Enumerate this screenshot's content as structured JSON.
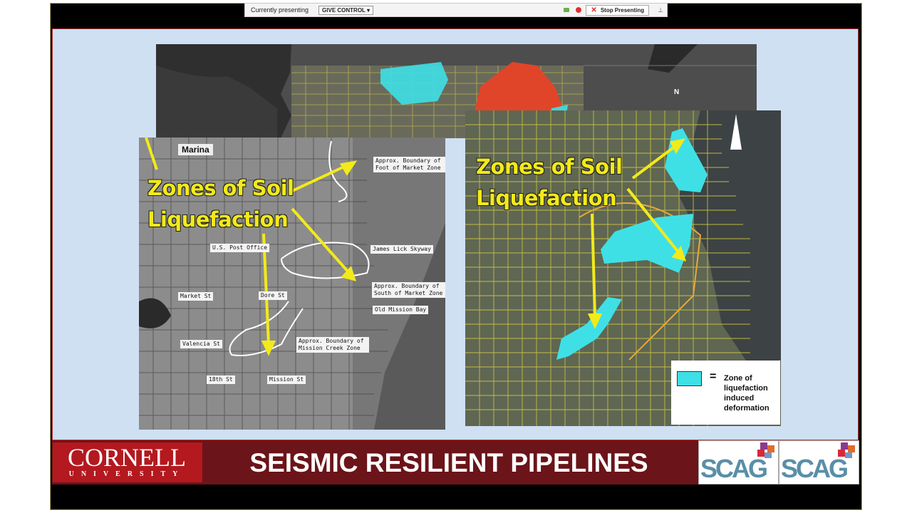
{
  "toolbar": {
    "currently_presenting": "Currently presenting",
    "give_control": "GIVE CONTROL",
    "stop_presenting": "Stop Presenting"
  },
  "slide": {
    "title": "SEISMIC RESILIENT PIPELINES",
    "cornell_line1": "CORNELL",
    "cornell_line2": "UNIVERSITY",
    "scag_logo": "SCAG",
    "left_map": {
      "heading_line1": "Zones of Soil",
      "heading_line2": "Liquefaction",
      "marina": "Marina",
      "labels": [
        "Approx. Boundary of Foot of Market Zone",
        "U.S. Post Office",
        "James Lick Skyway",
        "Approx. Boundary of South of Market Zone",
        "Market St",
        "Dore St",
        "Old Mission Bay",
        "Valencia St",
        "Approx. Boundary of Mission Creek Zone",
        "18th St",
        "Mission St"
      ]
    },
    "right_map": {
      "heading_line1": "Zones of Soil",
      "heading_line2": "Liquefaction",
      "north": "N",
      "legend_symbol": "=",
      "legend_text": "Zone of liquefaction induced deformation"
    }
  },
  "colors": {
    "liquefaction": "#3ee0e6",
    "red_zone": "#e0452a",
    "highlight_yellow": "#f2ea1a",
    "footer_maroon": "#6b1419",
    "cornell_red": "#b3191f"
  }
}
